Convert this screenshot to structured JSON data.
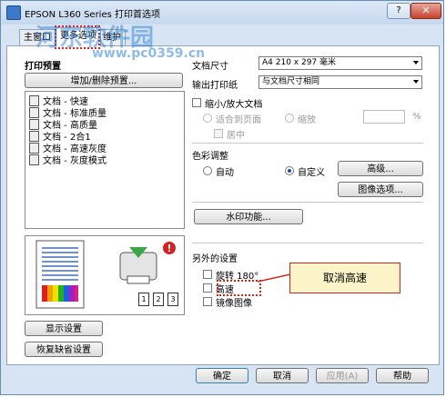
{
  "window": {
    "title": "EPSON L360 Series 打印首选项",
    "help_label": "?",
    "close_label": "✕"
  },
  "tabs": [
    {
      "label": "主窗口"
    },
    {
      "label": "更多选项"
    },
    {
      "label": "维护"
    }
  ],
  "watermark": {
    "text": "河东软件园",
    "url": "www.pc0359.cn"
  },
  "left": {
    "preset_title": "打印预置",
    "add_remove_button": "增加/删除预置...",
    "presets": [
      "文档 - 快速",
      "文档 - 标准质量",
      "文档 - 高质量",
      "文档 - 2合1",
      "文档 - 高速灰度",
      "文档 - 灰度模式"
    ],
    "page_icons": [
      "1",
      "2",
      "3"
    ],
    "show_settings_button": "显示设置",
    "restore_defaults_button": "恢复缺省设置"
  },
  "right": {
    "doc_size_label": "文档尺寸",
    "doc_size_value": "A4 210 x 297 毫米",
    "output_paper_label": "输出打印纸",
    "output_paper_value": "与文档尺寸相同",
    "reduce_enlarge_label": "缩小/放大文档",
    "fit_page_label": "适合到页面",
    "zoom_label": "缩放",
    "zoom_unit": "%",
    "center_label": "居中",
    "color_adjust_label": "色彩调整",
    "auto_label": "自动",
    "custom_label": "自定义",
    "advanced_button": "高级...",
    "image_options_button": "图像选项...",
    "watermark_button": "水印功能...",
    "extra_settings_label": "另外的设置",
    "rotate_label": "旋转 180°",
    "high_speed_label": "高速",
    "mirror_label": "镜像图像",
    "callout_text": "取消高速"
  },
  "footer": {
    "ok": "确定",
    "cancel": "取消",
    "apply": "应用(A)",
    "help": "帮助"
  },
  "colors": {
    "accent": "#d0261b",
    "callout_bg": "#fcf4c8",
    "window_frame": "#d6e4f3"
  }
}
